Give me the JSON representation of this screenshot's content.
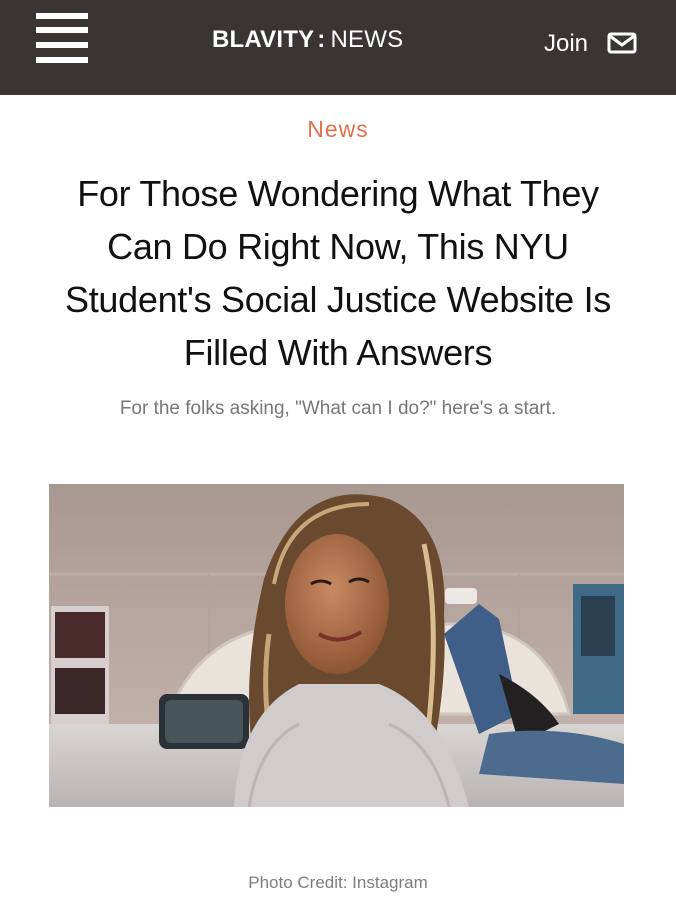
{
  "header": {
    "brand": "BLAVITY",
    "separator": ":",
    "section": "NEWS",
    "join_label": "Join",
    "menu_icon": "hamburger-menu-icon",
    "mail_icon": "envelope-icon",
    "bg_color": "#3a3533"
  },
  "article": {
    "category": "News",
    "category_color": "#e2704a",
    "headline": "For Those Wondering What They Can Do Right Now, This NYU Student's Social Justice Website Is Filled With Answers",
    "dek": "For the folks asking, \"What can I do?\" here's a start.",
    "photo_credit": "Photo Credit: Instagram"
  }
}
